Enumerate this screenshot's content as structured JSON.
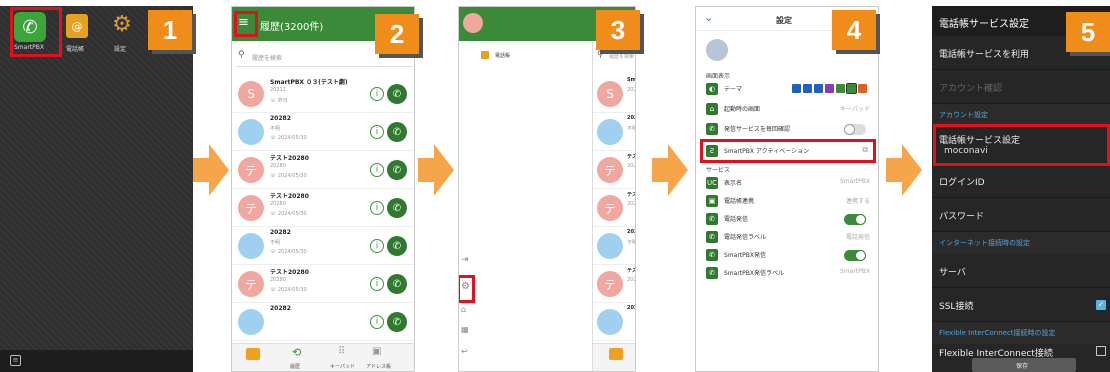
{
  "steps": {
    "s1": "1",
    "s2": "2",
    "s3": "3",
    "s4": "4",
    "s5": "5"
  },
  "colors": {
    "accent": "#f08c1a",
    "highlight": "#e0101c",
    "green": "#3a8a3a"
  },
  "screen1": {
    "apps": [
      {
        "label": "SmartPBX",
        "icon": "phone-icon"
      },
      {
        "label": "電話帳",
        "icon": "contacts-icon"
      },
      {
        "label": "設定",
        "icon": "gear-icon"
      }
    ]
  },
  "screen2": {
    "title": "履歴(3200件)",
    "search_placeholder": "履歴を検索",
    "items": [
      {
        "avatar": "S",
        "name": "SmartPBX ０３(テスト劇)",
        "number": "20211",
        "date": "昨日",
        "color": "#f0a7a0"
      },
      {
        "avatar": "",
        "name": "20282",
        "number": "不明",
        "date": "2024/05/30",
        "color": "#9fd0f0"
      },
      {
        "avatar": "テ",
        "name": "テスト20280",
        "number": "20280",
        "date": "2024/05/30",
        "color": "#f0a7a0"
      },
      {
        "avatar": "テ",
        "name": "テスト20280",
        "number": "20280",
        "date": "2024/05/30",
        "color": "#f0a7a0"
      },
      {
        "avatar": "",
        "name": "20282",
        "number": "不明",
        "date": "2024/05/30",
        "color": "#9fd0f0"
      },
      {
        "avatar": "テ",
        "name": "テスト20280",
        "number": "20280",
        "date": "2024/05/30",
        "color": "#f0a7a0"
      },
      {
        "avatar": "",
        "name": "20282",
        "number": "",
        "date": "",
        "color": "#9fd0f0"
      }
    ],
    "tabs": [
      {
        "label": "",
        "icon": "smartpbx-tab-icon"
      },
      {
        "label": "履歴",
        "icon": "history-icon"
      },
      {
        "label": "キーパッド",
        "icon": "keypad-icon"
      },
      {
        "label": "アドレス帳",
        "icon": "addressbook-icon"
      }
    ]
  },
  "screen3": {
    "menu_item": "電話帳",
    "search_placeholder": "履歴を検索",
    "peek": [
      {
        "avatar": "S",
        "name": "Sma",
        "number": "202",
        "color": "#f0a7a0"
      },
      {
        "avatar": "",
        "name": "202",
        "number": "不明",
        "color": "#9fd0f0"
      },
      {
        "avatar": "テ",
        "name": "テス",
        "number": "202",
        "color": "#f0a7a0"
      },
      {
        "avatar": "テ",
        "name": "テス",
        "number": "202",
        "color": "#f0a7a0"
      },
      {
        "avatar": "",
        "name": "202",
        "number": "不明",
        "color": "#9fd0f0"
      },
      {
        "avatar": "テ",
        "name": "テス",
        "number": "202",
        "color": "#f0a7a0"
      },
      {
        "avatar": "",
        "name": "202",
        "number": "",
        "color": "#9fd0f0"
      }
    ]
  },
  "screen4": {
    "title": "設定",
    "section_display": "画面表示",
    "theme_label": "テーマ",
    "theme_colors": [
      "#2060c0",
      "#2060c0",
      "#2060c0",
      "#8a3ab8",
      "#3a8a3a",
      "#3a8a3a",
      "#e06020"
    ],
    "startup_label": "起動時の画面",
    "startup_value": "キーパッド",
    "confirm_label": "発信サービスを毎回確認",
    "activation_label": "SmartPBX アクティベーション",
    "section_service": "サービス",
    "rows": [
      {
        "icon": "UC",
        "label": "表示名",
        "value": "SmartPBX",
        "type": "value"
      },
      {
        "icon": "▣",
        "label": "電話帳連携",
        "value": "連携する",
        "type": "value"
      },
      {
        "icon": "✆",
        "label": "電話発信",
        "value": "",
        "type": "on"
      },
      {
        "icon": "✆",
        "label": "電話発信ラベル",
        "value": "電話発信",
        "type": "value"
      },
      {
        "icon": "✆",
        "label": "SmartPBX発信",
        "value": "",
        "type": "on"
      },
      {
        "icon": "✆",
        "label": "SmartPBX発信ラベル",
        "value": "SmartPBX",
        "type": "value"
      }
    ]
  },
  "screen5": {
    "header": "電話帳サービス設定",
    "use_service": "電話帳サービスを利用",
    "account_confirm": "アカウント確認",
    "section_account": "アカウント設定",
    "service_setting": "電話帳サービス設定",
    "service_value": "moconavi",
    "login_id": "ログインID",
    "password": "パスワード",
    "section_internet": "インターネット接続時の設定",
    "server": "サーバ",
    "ssl": "SSL接続",
    "ssl_checked": true,
    "section_fic": "Flexible InterConnect接続時の設定",
    "fic": "Flexible InterConnect接続",
    "fic_checked": false,
    "save": "保存"
  }
}
